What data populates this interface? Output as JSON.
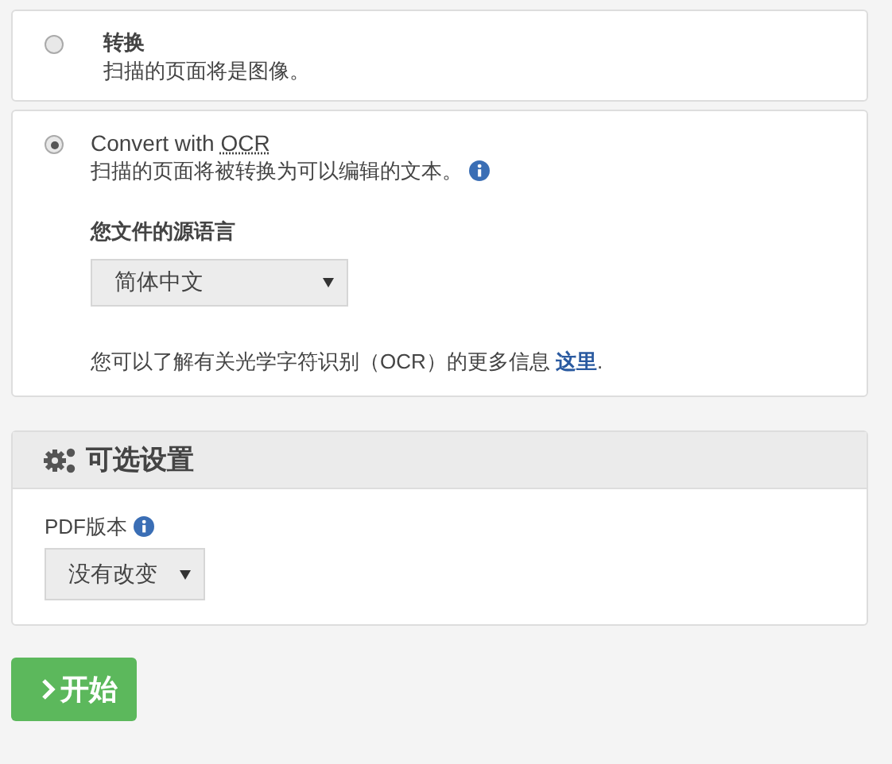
{
  "conversion_options": [
    {
      "title": "转换",
      "description": "扫描的页面将是图像。",
      "selected": false,
      "info": false
    },
    {
      "title": "Convert with",
      "title_abbr": "OCR",
      "description": "扫描的页面将被转换为可以编辑的文本。",
      "selected": true,
      "info": true,
      "language_label": "您文件的源语言",
      "language_value": "简体中文",
      "note": "您可以了解有关光学字符识别（OCR）的更多信息 ",
      "note_link": "这里",
      "note_end": "."
    }
  ],
  "optional_settings": {
    "title": "可选设置",
    "pdf_version_label": "PDF版本",
    "pdf_version_value": "没有改变"
  },
  "start_button": {
    "label": "开始"
  }
}
